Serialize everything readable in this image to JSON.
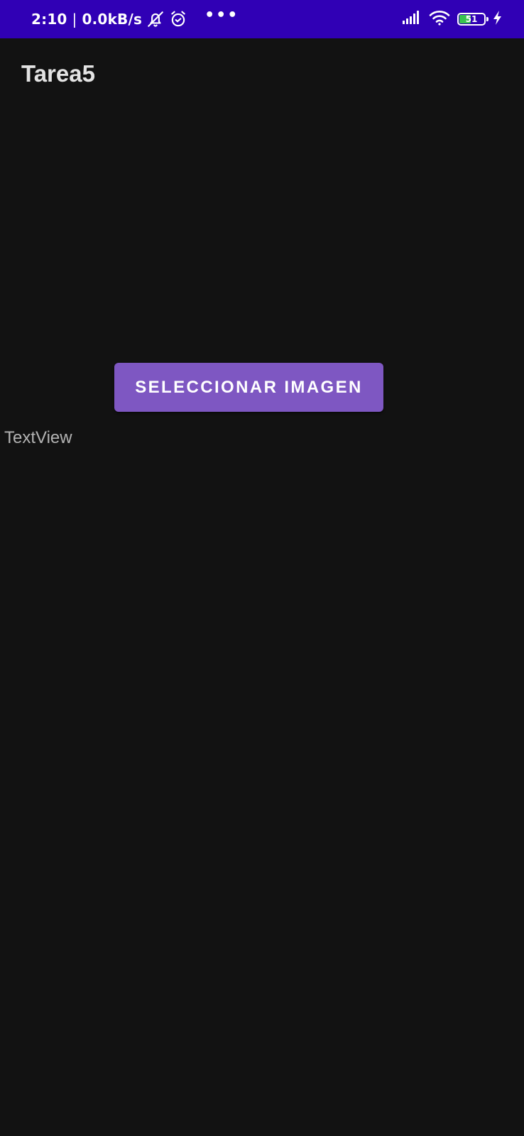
{
  "status_bar": {
    "time": "2:10",
    "separator": "|",
    "network_speed": "0.0kB/s",
    "more_indicator": "•••",
    "battery_level": "51",
    "background_color": "#3000b5",
    "icons": [
      "bell-off-icon",
      "alarm-icon",
      "more-icon",
      "signal-icon",
      "wifi-icon",
      "battery-icon",
      "charging-icon"
    ]
  },
  "app": {
    "title": "Tarea5",
    "background_color": "#121212"
  },
  "main": {
    "select_image_button": "SELECCIONAR IMAGEN",
    "button_color": "#7e57c2",
    "text_view": "TextView"
  }
}
